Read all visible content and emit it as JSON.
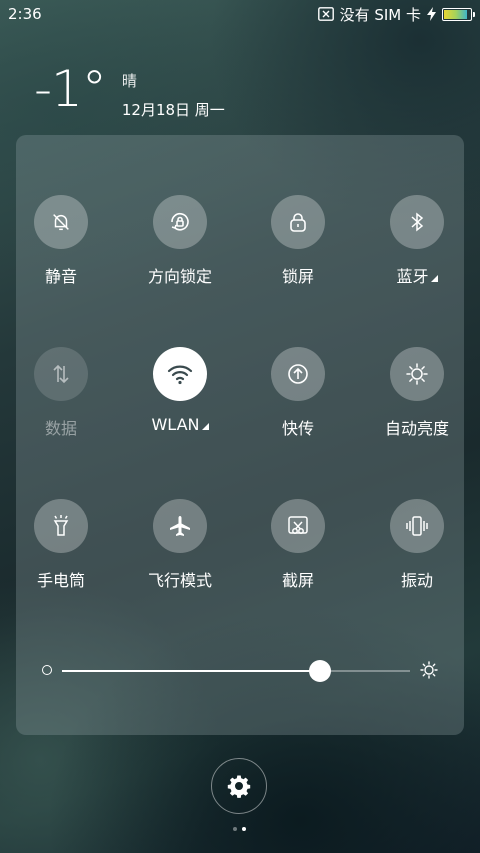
{
  "status_bar": {
    "time": "2:36",
    "sim_text": "没有 SIM 卡",
    "battery_level": 0.9,
    "icons": [
      "sim-card-x-icon",
      "charging-bolt-icon",
      "battery-icon"
    ]
  },
  "weather": {
    "temperature": "-1°",
    "condition": "晴",
    "date": "12月18日 周一"
  },
  "tiles": [
    {
      "label": "静音",
      "icon": "bell-off-icon",
      "state": "off"
    },
    {
      "label": "方向锁定",
      "icon": "rotation-lock-icon",
      "state": "off"
    },
    {
      "label": "锁屏",
      "icon": "lock-icon",
      "state": "off"
    },
    {
      "label": "蓝牙",
      "icon": "bluetooth-icon",
      "state": "off",
      "has_menu": true
    },
    {
      "label": "数据",
      "icon": "mobile-data-icon",
      "state": "disabled"
    },
    {
      "label": "WLAN",
      "icon": "wifi-icon",
      "state": "on",
      "has_menu": true
    },
    {
      "label": "快传",
      "icon": "upload-icon",
      "state": "off"
    },
    {
      "label": "自动亮度",
      "icon": "auto-brightness-icon",
      "state": "off"
    },
    {
      "label": "手电筒",
      "icon": "flashlight-icon",
      "state": "off"
    },
    {
      "label": "飞行模式",
      "icon": "airplane-icon",
      "state": "off"
    },
    {
      "label": "截屏",
      "icon": "screenshot-icon",
      "state": "off"
    },
    {
      "label": "振动",
      "icon": "vibrate-icon",
      "state": "off"
    }
  ],
  "brightness": {
    "level": 0.74
  },
  "pager": {
    "pages": 2,
    "current": 2
  },
  "colors": {
    "active_tile": "#ffffff",
    "active_icon": "#3a4a4e"
  }
}
